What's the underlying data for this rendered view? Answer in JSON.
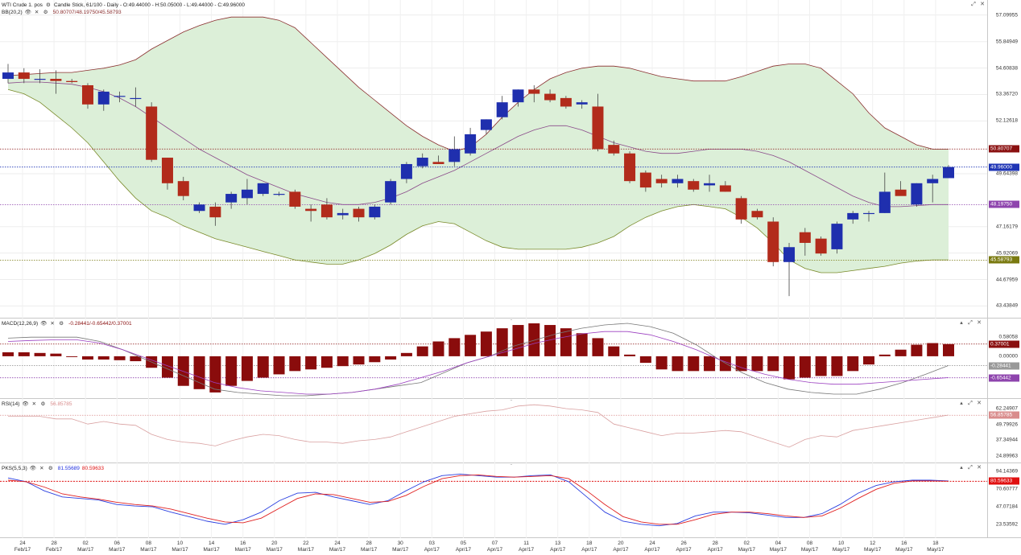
{
  "main": {
    "symbol": "WTI Crude 1. pos",
    "ohlc": "Candle Stick, 61/100 - Daily - O:49.44000 - H:50.05000 - L:49.44000 - C:49.96000",
    "indicator_name": "BB(20,2)",
    "indicator_values": "50.80707/48.19750/45.58793",
    "y_ticks": [
      "57.09955",
      "55.84949",
      "54.60838",
      "53.36720",
      "52.12618",
      "49.64398",
      "47.16179",
      "45.92069",
      "44.67959",
      "43.43849"
    ],
    "badges": [
      {
        "label": "50.80707",
        "value": 50.80707,
        "color": "#8a1010"
      },
      {
        "label": "49.96000",
        "value": 49.96,
        "color": "#1f35b5"
      },
      {
        "label": "48.19750",
        "value": 48.1975,
        "color": "#8e44ad"
      },
      {
        "label": "45.58793",
        "value": 45.58793,
        "color": "#7a7a10"
      }
    ]
  },
  "macd": {
    "name": "MACD(12,26,9)",
    "values": "-0.28441/-0.65442/0.37001",
    "y_ticks": [
      "0.58058",
      "0.00000"
    ],
    "badges": [
      {
        "label": "0.37001",
        "value": 0.37001,
        "color": "#8a1010"
      },
      {
        "label": "-0.28441",
        "value": -0.28441,
        "color": "#999999"
      },
      {
        "label": "-0.65442",
        "value": -0.65442,
        "color": "#8e44ad"
      }
    ]
  },
  "rsi": {
    "name": "RSI(14)",
    "values": "56.85785",
    "y_ticks": [
      "62.24907",
      "49.79926",
      "37.34944",
      "24.89963"
    ],
    "badges": [
      {
        "label": "56.85785",
        "value": 56.85785,
        "color": "#d98c8c"
      }
    ]
  },
  "pks": {
    "name": "PKS(5,5,3)",
    "values_blue": "81.55689",
    "values_red": "80.59633",
    "y_ticks": [
      "94.14369",
      "70.60777",
      "47.07184",
      "23.53592"
    ],
    "badges": [
      {
        "label": "80.59633",
        "value": 80.59633,
        "color": "#e01010"
      }
    ]
  },
  "x_labels": [
    {
      "day": "24",
      "month": "Feb/17"
    },
    {
      "day": "28",
      "month": "Feb/17"
    },
    {
      "day": "02",
      "month": "Mar/17"
    },
    {
      "day": "06",
      "month": "Mar/17"
    },
    {
      "day": "08",
      "month": "Mar/17"
    },
    {
      "day": "10",
      "month": "Mar/17"
    },
    {
      "day": "14",
      "month": "Mar/17"
    },
    {
      "day": "16",
      "month": "Mar/17"
    },
    {
      "day": "20",
      "month": "Mar/17"
    },
    {
      "day": "22",
      "month": "Mar/17"
    },
    {
      "day": "24",
      "month": "Mar/17"
    },
    {
      "day": "28",
      "month": "Mar/17"
    },
    {
      "day": "30",
      "month": "Mar/17"
    },
    {
      "day": "03",
      "month": "Apr/17"
    },
    {
      "day": "05",
      "month": "Apr/17"
    },
    {
      "day": "07",
      "month": "Apr/17"
    },
    {
      "day": "11",
      "month": "Apr/17"
    },
    {
      "day": "13",
      "month": "Apr/17"
    },
    {
      "day": "18",
      "month": "Apr/17"
    },
    {
      "day": "20",
      "month": "Apr/17"
    },
    {
      "day": "24",
      "month": "Apr/17"
    },
    {
      "day": "26",
      "month": "Apr/17"
    },
    {
      "day": "28",
      "month": "Apr/17"
    },
    {
      "day": "02",
      "month": "May/17"
    },
    {
      "day": "04",
      "month": "May/17"
    },
    {
      "day": "08",
      "month": "May/17"
    },
    {
      "day": "10",
      "month": "May/17"
    },
    {
      "day": "12",
      "month": "May/17"
    },
    {
      "day": "16",
      "month": "May/17"
    },
    {
      "day": "18",
      "month": "May/17"
    }
  ],
  "colors": {
    "bull": "#1f2fae",
    "bear": "#b22b1b",
    "band_fill": "#dcefd8",
    "upper_band": "#8a2f2f",
    "lower_band": "#7a8a2a",
    "mid_band": "#8a4a8a"
  },
  "chart_data": [
    {
      "type": "candlestick",
      "title": "WTI Crude 1. pos",
      "ylim": [
        43.0,
        57.5
      ],
      "candles": [
        {
          "o": 54.1,
          "h": 54.8,
          "l": 53.9,
          "c": 54.4
        },
        {
          "o": 54.4,
          "h": 54.6,
          "l": 53.9,
          "c": 54.1
        },
        {
          "o": 54.1,
          "h": 54.55,
          "l": 53.9,
          "c": 54.1
        },
        {
          "o": 54.1,
          "h": 54.5,
          "l": 53.4,
          "c": 54.0
        },
        {
          "o": 54.0,
          "h": 54.1,
          "l": 53.9,
          "c": 53.95
        },
        {
          "o": 53.8,
          "h": 53.9,
          "l": 52.7,
          "c": 52.9
        },
        {
          "o": 52.9,
          "h": 53.6,
          "l": 52.6,
          "c": 53.5
        },
        {
          "o": 53.3,
          "h": 53.5,
          "l": 53.0,
          "c": 53.3
        },
        {
          "o": 53.2,
          "h": 53.7,
          "l": 52.8,
          "c": 53.2
        },
        {
          "o": 52.8,
          "h": 53.0,
          "l": 50.2,
          "c": 50.3
        },
        {
          "o": 50.4,
          "h": 50.4,
          "l": 48.9,
          "c": 49.2
        },
        {
          "o": 49.3,
          "h": 49.5,
          "l": 48.4,
          "c": 48.6
        },
        {
          "o": 47.9,
          "h": 48.3,
          "l": 47.8,
          "c": 48.2
        },
        {
          "o": 48.1,
          "h": 48.3,
          "l": 47.2,
          "c": 47.6
        },
        {
          "o": 48.3,
          "h": 48.8,
          "l": 48.0,
          "c": 48.7
        },
        {
          "o": 48.5,
          "h": 49.4,
          "l": 48.2,
          "c": 48.9
        },
        {
          "o": 48.7,
          "h": 49.2,
          "l": 48.6,
          "c": 49.2
        },
        {
          "o": 48.7,
          "h": 48.8,
          "l": 48.6,
          "c": 48.7
        },
        {
          "o": 48.8,
          "h": 48.9,
          "l": 48.0,
          "c": 48.1
        },
        {
          "o": 48.0,
          "h": 48.2,
          "l": 47.4,
          "c": 47.9
        },
        {
          "o": 48.2,
          "h": 48.5,
          "l": 47.5,
          "c": 47.6
        },
        {
          "o": 47.7,
          "h": 48.0,
          "l": 47.5,
          "c": 47.8
        },
        {
          "o": 48.0,
          "h": 48.1,
          "l": 47.4,
          "c": 47.6
        },
        {
          "o": 47.6,
          "h": 48.2,
          "l": 47.5,
          "c": 48.1
        },
        {
          "o": 48.3,
          "h": 49.4,
          "l": 48.2,
          "c": 49.3
        },
        {
          "o": 49.4,
          "h": 50.2,
          "l": 49.2,
          "c": 50.1
        },
        {
          "o": 50.0,
          "h": 50.6,
          "l": 49.9,
          "c": 50.4
        },
        {
          "o": 50.2,
          "h": 50.5,
          "l": 50.1,
          "c": 50.1
        },
        {
          "o": 50.2,
          "h": 51.4,
          "l": 50.0,
          "c": 50.8
        },
        {
          "o": 50.6,
          "h": 51.8,
          "l": 50.5,
          "c": 51.5
        },
        {
          "o": 51.7,
          "h": 52.2,
          "l": 51.5,
          "c": 52.2
        },
        {
          "o": 52.3,
          "h": 53.3,
          "l": 52.2,
          "c": 53.0
        },
        {
          "o": 53.0,
          "h": 53.6,
          "l": 52.8,
          "c": 53.6
        },
        {
          "o": 53.6,
          "h": 53.8,
          "l": 53.0,
          "c": 53.4
        },
        {
          "o": 53.4,
          "h": 53.6,
          "l": 53.0,
          "c": 53.1
        },
        {
          "o": 53.2,
          "h": 53.3,
          "l": 52.7,
          "c": 52.8
        },
        {
          "o": 52.9,
          "h": 53.1,
          "l": 52.7,
          "c": 53.0
        },
        {
          "o": 52.8,
          "h": 53.4,
          "l": 50.7,
          "c": 50.8
        },
        {
          "o": 51.0,
          "h": 51.2,
          "l": 50.5,
          "c": 50.6
        },
        {
          "o": 50.6,
          "h": 50.7,
          "l": 49.2,
          "c": 49.3
        },
        {
          "o": 49.7,
          "h": 49.8,
          "l": 48.8,
          "c": 49.0
        },
        {
          "o": 49.4,
          "h": 49.6,
          "l": 49.0,
          "c": 49.2
        },
        {
          "o": 49.2,
          "h": 49.6,
          "l": 49.0,
          "c": 49.4
        },
        {
          "o": 49.3,
          "h": 49.4,
          "l": 48.8,
          "c": 48.9
        },
        {
          "o": 49.1,
          "h": 49.6,
          "l": 48.8,
          "c": 49.2
        },
        {
          "o": 49.1,
          "h": 49.3,
          "l": 48.8,
          "c": 48.8
        },
        {
          "o": 48.5,
          "h": 48.6,
          "l": 47.3,
          "c": 47.5
        },
        {
          "o": 47.9,
          "h": 48.0,
          "l": 47.5,
          "c": 47.6
        },
        {
          "o": 47.4,
          "h": 47.6,
          "l": 45.3,
          "c": 45.5
        },
        {
          "o": 45.5,
          "h": 46.4,
          "l": 43.9,
          "c": 46.2
        },
        {
          "o": 46.9,
          "h": 47.1,
          "l": 45.8,
          "c": 46.4
        },
        {
          "o": 46.6,
          "h": 46.7,
          "l": 45.8,
          "c": 45.9
        },
        {
          "o": 46.1,
          "h": 47.4,
          "l": 45.9,
          "c": 47.3
        },
        {
          "o": 47.5,
          "h": 47.9,
          "l": 47.3,
          "c": 47.8
        },
        {
          "o": 47.8,
          "h": 47.9,
          "l": 47.4,
          "c": 47.8
        },
        {
          "o": 47.8,
          "h": 49.7,
          "l": 47.8,
          "c": 48.8
        },
        {
          "o": 48.9,
          "h": 49.3,
          "l": 48.7,
          "c": 48.6
        },
        {
          "o": 48.2,
          "h": 49.2,
          "l": 48.1,
          "c": 49.2
        },
        {
          "o": 49.2,
          "h": 49.6,
          "l": 48.3,
          "c": 49.4
        },
        {
          "o": 49.44,
          "h": 50.05,
          "l": 49.44,
          "c": 49.96
        }
      ],
      "upper_band": [
        54.25,
        54.3,
        54.35,
        54.4,
        54.4,
        54.5,
        54.6,
        54.75,
        55.0,
        55.5,
        55.9,
        56.3,
        56.6,
        56.85,
        57.0,
        57.0,
        57.0,
        56.85,
        56.5,
        55.8,
        55.1,
        54.4,
        53.7,
        53.1,
        52.5,
        51.9,
        51.4,
        51.0,
        50.7,
        50.9,
        51.5,
        52.3,
        53.0,
        53.6,
        54.1,
        54.4,
        54.6,
        54.7,
        54.7,
        54.6,
        54.4,
        54.2,
        54.1,
        54.0,
        54.0,
        54.0,
        54.2,
        54.45,
        54.7,
        54.8,
        54.8,
        54.6,
        54.0,
        53.4,
        52.5,
        51.8,
        51.4,
        51.0,
        50.8,
        50.8
      ],
      "lower_band": [
        53.6,
        53.4,
        53.0,
        52.4,
        51.8,
        51.1,
        50.2,
        49.3,
        48.5,
        47.9,
        47.6,
        47.2,
        46.9,
        46.6,
        46.4,
        46.2,
        46.0,
        45.8,
        45.6,
        45.5,
        45.4,
        45.4,
        45.6,
        45.9,
        46.3,
        46.8,
        47.2,
        47.4,
        47.3,
        46.9,
        46.5,
        46.2,
        46.1,
        46.1,
        46.1,
        46.1,
        46.2,
        46.4,
        46.7,
        47.2,
        47.6,
        47.9,
        48.1,
        48.2,
        48.1,
        48.0,
        47.6,
        47.1,
        46.4,
        45.6,
        45.2,
        45.0,
        45.0,
        45.1,
        45.2,
        45.3,
        45.45,
        45.55,
        45.6,
        45.6
      ],
      "mid_band": [
        53.9,
        53.95,
        53.95,
        53.9,
        53.85,
        53.7,
        53.5,
        53.2,
        52.8,
        52.3,
        51.8,
        51.3,
        50.8,
        50.4,
        50.0,
        49.6,
        49.3,
        49.0,
        48.7,
        48.5,
        48.3,
        48.2,
        48.2,
        48.3,
        48.5,
        48.8,
        49.2,
        49.5,
        49.8,
        50.2,
        50.6,
        51.0,
        51.4,
        51.7,
        51.9,
        51.9,
        51.7,
        51.4,
        51.1,
        50.9,
        50.7,
        50.6,
        50.6,
        50.7,
        50.8,
        50.8,
        50.8,
        50.7,
        50.5,
        50.2,
        49.8,
        49.4,
        49.0,
        48.6,
        48.3,
        48.1,
        48.1,
        48.15,
        48.2,
        48.2
      ]
    },
    {
      "type": "bar+line",
      "title": "MACD(12,26,9)",
      "ylim": [
        -1.2,
        1.0
      ],
      "histogram": [
        0.12,
        0.12,
        0.1,
        0.08,
        0.0,
        -0.1,
        -0.1,
        -0.12,
        -0.15,
        -0.35,
        -0.65,
        -0.9,
        -1.0,
        -1.1,
        -0.9,
        -0.75,
        -0.65,
        -0.55,
        -0.45,
        -0.4,
        -0.35,
        -0.3,
        -0.25,
        -0.18,
        -0.1,
        0.1,
        0.3,
        0.45,
        0.55,
        0.65,
        0.75,
        0.85,
        0.95,
        1.0,
        0.95,
        0.85,
        0.7,
        0.55,
        0.3,
        0.05,
        -0.2,
        -0.4,
        -0.45,
        -0.45,
        -0.45,
        -0.45,
        -0.45,
        -0.45,
        -0.45,
        -0.7,
        -0.65,
        -0.6,
        -0.6,
        -0.45,
        -0.25,
        0.05,
        0.2,
        0.35,
        0.4,
        0.37
      ],
      "macd_line": [
        0.55,
        0.58,
        0.58,
        0.58,
        0.45,
        0.2,
        -0.1,
        -0.4,
        -0.7,
        -1.0,
        -1.1,
        -1.15,
        -1.2,
        -1.2,
        -1.15,
        -1.1,
        -1.0,
        -0.9,
        -0.8,
        -0.5,
        -0.2,
        0.0,
        0.3,
        0.5,
        0.7,
        0.85,
        0.95,
        1.0,
        0.9,
        0.7,
        0.35,
        -0.1,
        -0.5,
        -0.8,
        -1.0,
        -1.1,
        -1.15,
        -1.15,
        -1.0,
        -0.8,
        -0.55,
        -0.28
      ],
      "signal_line": [
        0.45,
        0.48,
        0.5,
        0.5,
        0.4,
        0.2,
        -0.05,
        -0.3,
        -0.55,
        -0.8,
        -0.95,
        -1.05,
        -1.1,
        -1.15,
        -1.15,
        -1.1,
        -1.0,
        -0.85,
        -0.65,
        -0.45,
        -0.2,
        0.0,
        0.2,
        0.4,
        0.55,
        0.68,
        0.75,
        0.75,
        0.65,
        0.45,
        0.2,
        -0.1,
        -0.35,
        -0.55,
        -0.7,
        -0.8,
        -0.85,
        -0.85,
        -0.8,
        -0.75,
        -0.7,
        -0.65
      ]
    },
    {
      "type": "line",
      "title": "RSI(14)",
      "ylim": [
        22,
        67
      ],
      "values": [
        56,
        56,
        56,
        54,
        54,
        50,
        52,
        50,
        49,
        42,
        38,
        36,
        35,
        33,
        37,
        40,
        42,
        41,
        38,
        36,
        36,
        35,
        37,
        38,
        40,
        44,
        48,
        52,
        56,
        58,
        60,
        61,
        64,
        65,
        64,
        62,
        61,
        59,
        50,
        47,
        44,
        41,
        43,
        43,
        44,
        45,
        44,
        40,
        36,
        32,
        38,
        41,
        40,
        45,
        47,
        49,
        51,
        53,
        55,
        57
      ]
    },
    {
      "type": "line",
      "title": "PKS(5,5,3)",
      "ylim": [
        10,
        100
      ],
      "blue": [
        85,
        80,
        68,
        60,
        58,
        56,
        50,
        48,
        47,
        40,
        34,
        28,
        24,
        30,
        40,
        55,
        65,
        66,
        60,
        55,
        50,
        55,
        68,
        80,
        88,
        90,
        88,
        86,
        86,
        88,
        89,
        80,
        60,
        40,
        28,
        24,
        22,
        25,
        35,
        40,
        40,
        39,
        36,
        33,
        33,
        38,
        50,
        65,
        75,
        80,
        82,
        82,
        81
      ],
      "red": [
        82,
        80,
        73,
        64,
        60,
        57,
        53,
        50,
        48,
        44,
        38,
        32,
        27,
        26,
        32,
        45,
        58,
        64,
        63,
        58,
        53,
        54,
        62,
        74,
        84,
        88,
        89,
        87,
        86,
        87,
        88,
        84,
        68,
        50,
        34,
        27,
        24,
        24,
        30,
        37,
        40,
        40,
        38,
        35,
        33,
        35,
        45,
        58,
        70,
        78,
        81,
        81,
        80.6
      ]
    }
  ]
}
